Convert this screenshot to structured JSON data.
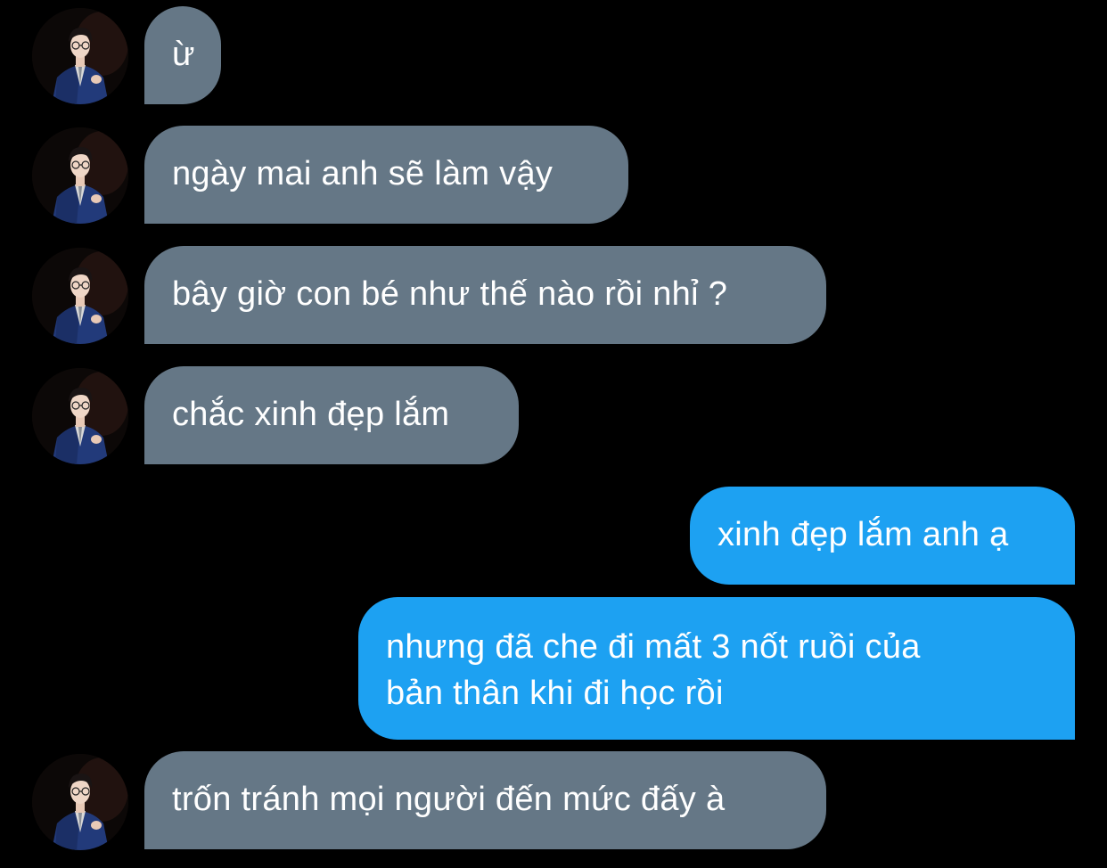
{
  "conversation": {
    "messages": [
      {
        "direction": "incoming",
        "text": "ừ"
      },
      {
        "direction": "incoming",
        "text": "ngày mai anh sẽ làm vậy"
      },
      {
        "direction": "incoming",
        "text": "bây giờ con bé như thế nào rồi nhỉ ?"
      },
      {
        "direction": "incoming",
        "text": "chắc xinh đẹp lắm"
      },
      {
        "direction": "outgoing",
        "text": "xinh đẹp lắm anh ạ"
      },
      {
        "direction": "outgoing",
        "line1": "nhưng đã che đi mất 3 nốt ruồi của",
        "line2": "bản thân khi đi học rồi"
      },
      {
        "direction": "incoming",
        "text": "trốn tránh mọi người đến mức đấy à"
      }
    ]
  },
  "colors": {
    "background": "#000000",
    "incoming_bubble": "#657786",
    "outgoing_bubble": "#1da1f2",
    "text": "#ffffff"
  },
  "icons": {
    "avatar": "contact-avatar-photo"
  }
}
